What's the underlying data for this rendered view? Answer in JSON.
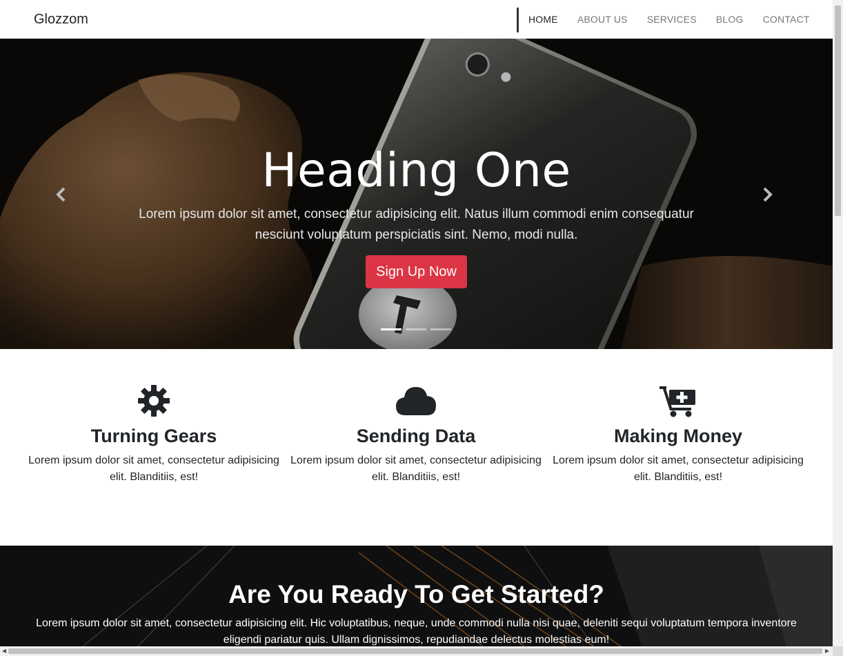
{
  "navbar": {
    "brand": "Glozzom",
    "links": [
      "HOME",
      "ABOUT US",
      "SERVICES",
      "BLOG",
      "CONTACT"
    ],
    "active_index": 0
  },
  "hero": {
    "title": "Heading One",
    "text": "Lorem ipsum dolor sit amet, consectetur adipisicing elit. Natus illum commodi enim consequatur nesciunt voluptatum perspiciatis sint. Nemo, modi nulla.",
    "button_label": "Sign Up Now",
    "prev_icon": "chevron-left-icon",
    "next_icon": "chevron-right-icon",
    "indicator_count": 3,
    "active_indicator": 0
  },
  "features": [
    {
      "icon": "gear-icon",
      "title": "Turning Gears",
      "text": "Lorem ipsum dolor sit amet, consectetur adipisicing elit. Blanditiis, est!"
    },
    {
      "icon": "cloud-icon",
      "title": "Sending Data",
      "text": "Lorem ipsum dolor sit amet, consectetur adipisicing elit. Blanditiis, est!"
    },
    {
      "icon": "cart-plus-icon",
      "title": "Making Money",
      "text": "Lorem ipsum dolor sit amet, consectetur adipisicing elit. Blanditiis, est!"
    }
  ],
  "cta": {
    "title": "Are You Ready To Get Started?",
    "text": "Lorem ipsum dolor sit amet, consectetur adipisicing elit. Hic voluptatibus, neque, unde commodi nulla nisi quae, deleniti sequi voluptatum tempora inventore eligendi pariatur quis. Ullam dignissimos, repudiandae delectus molestias eum!"
  },
  "colors": {
    "accent": "#dc3545",
    "text": "#212529",
    "nav_inactive": "#777777"
  }
}
